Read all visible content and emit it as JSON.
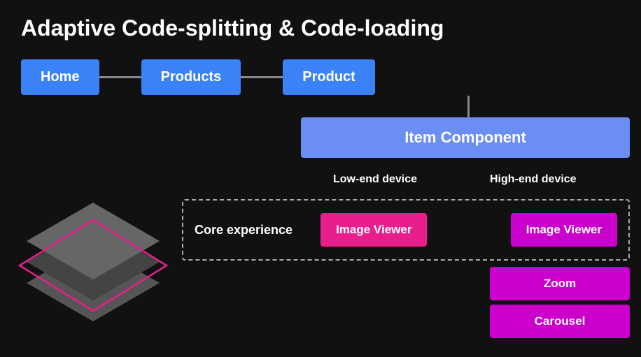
{
  "title": "Adaptive Code-splitting & Code-loading",
  "routes": [
    {
      "label": "Home"
    },
    {
      "label": "Products"
    },
    {
      "label": "Product"
    }
  ],
  "item_component": "Item Component",
  "device_labels": {
    "low_end": "Low-end device",
    "high_end": "High-end device"
  },
  "core_experience_label": "Core experience",
  "image_viewer_label": "Image Viewer",
  "zoom_label": "Zoom",
  "carousel_label": "Carousel",
  "colors": {
    "route_box": "#3b82f6",
    "item_component": "#6b8ef5",
    "image_viewer_pink": "#e91e8c",
    "image_viewer_magenta": "#cc00cc",
    "zoom": "#cc00cc",
    "carousel": "#cc00cc"
  }
}
